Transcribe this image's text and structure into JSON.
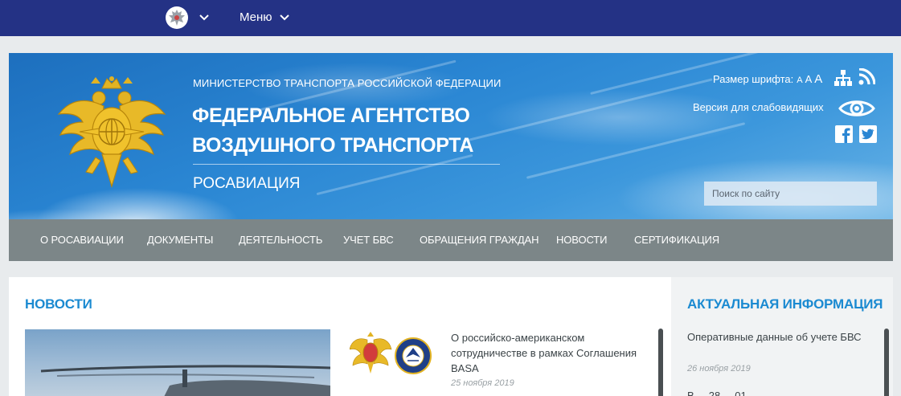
{
  "topbar": {
    "menu_label": "Меню",
    "background": "#243285"
  },
  "header": {
    "ministry": "МИНИСТЕРСТВО ТРАНСПОРТА РОССИЙСКОЙ ФЕДЕРАЦИИ",
    "agency_line1": "ФЕДЕРАЛЬНОЕ АГЕНТСТВО",
    "agency_line2": "ВОЗДУШНОГО ТРАНСПОРТА",
    "short_name": "РОСАВИАЦИЯ",
    "font_size_label": "Размер шрифта:",
    "font_size_options": [
      "A",
      "A",
      "A"
    ],
    "low_vision_label": "Версия для слабовидящих",
    "search_placeholder": "Поиск по сайту"
  },
  "nav": {
    "items": [
      "О РОСАВИАЦИИ",
      "ДОКУМЕНТЫ",
      "ДЕЯТЕЛЬНОСТЬ",
      "УЧЕТ БВС",
      "ОБРАЩЕНИЯ ГРАЖДАН",
      "НОВОСТИ",
      "СЕРТИФИКАЦИЯ"
    ],
    "background": "#7c8688"
  },
  "news": {
    "section_title": "НОВОСТИ",
    "items": [
      {
        "title": "О российско-американском сотрудничестве в рамках Соглашения BASA",
        "date": "25 ноября 2019"
      }
    ]
  },
  "info": {
    "section_title": "АКТУАЛЬНАЯ ИНФОРМАЦИЯ",
    "items": [
      {
        "title": "Оперативные данные об учете БВС",
        "date": "26 ноября 2019"
      },
      {
        "title": "В ... 28 ... 01"
      }
    ]
  },
  "colors": {
    "accent": "#1b8ad1",
    "text": "#3b4347",
    "date": "#9aa1a5",
    "emblem_gold": "#e2b323"
  }
}
